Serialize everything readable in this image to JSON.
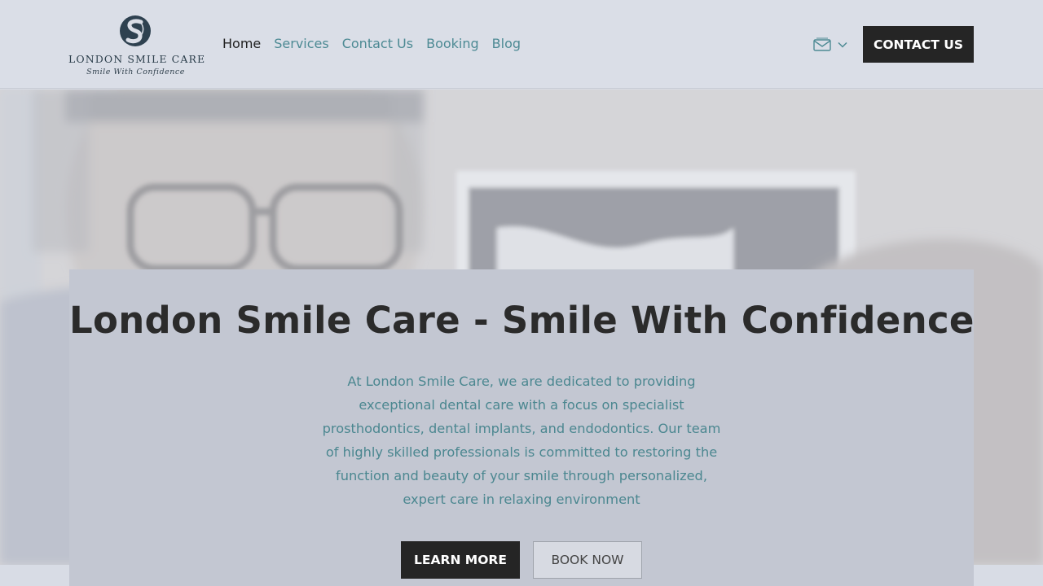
{
  "brand": {
    "name": "LONDON SMILE CARE",
    "tagline": "Smile With Confidence",
    "logo_icon": "s-monogram-logo"
  },
  "nav": {
    "items": [
      {
        "label": "Home",
        "active": true
      },
      {
        "label": "Services",
        "active": false
      },
      {
        "label": "Contact Us",
        "active": false
      },
      {
        "label": "Booking",
        "active": false
      },
      {
        "label": "Blog",
        "active": false
      }
    ]
  },
  "header": {
    "mail_icon": "mail-icon",
    "dropdown_icon": "chevron-down-icon",
    "contact_button": "CONTACT US"
  },
  "hero": {
    "title": "London Smile Care - Smile With Confidence",
    "body": "At London Smile Care, we are dedicated to providing exceptional dental care with a focus on specialist prosthodontics, dental implants, and endodontics. Our team of highly skilled professionals is committed to restoring the function and beauty of your smile through personalized, expert care in relaxing environment",
    "primary_button": "LEARN MORE",
    "secondary_button": "BOOK NOW"
  },
  "colors": {
    "accent_teal": "#4d8a94",
    "dark_button": "#252525",
    "header_bg": "#dadee7",
    "card_bg": "#c3c7d2"
  }
}
